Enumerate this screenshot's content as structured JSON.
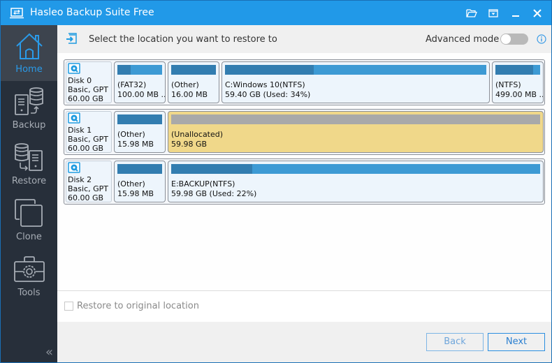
{
  "window": {
    "title": "Hasleo Backup Suite Free",
    "accent_color": "#2199e8",
    "titlebar_buttons": [
      "open-folder",
      "menu",
      "minimize",
      "close"
    ]
  },
  "sidebar": {
    "items": [
      {
        "label": "Home",
        "icon": "home-icon",
        "active": true
      },
      {
        "label": "Backup",
        "icon": "backup-icon",
        "active": false
      },
      {
        "label": "Restore",
        "icon": "restore-icon",
        "active": false
      },
      {
        "label": "Clone",
        "icon": "clone-icon",
        "active": false
      },
      {
        "label": "Tools",
        "icon": "tools-icon",
        "active": false
      }
    ],
    "collapse_glyph": "«"
  },
  "header": {
    "instruction": "Select the location you want to restore to",
    "advanced_mode_label": "Advanced mode",
    "advanced_mode_on": false
  },
  "disks": [
    {
      "name": "Disk 0",
      "type": "Basic, GPT",
      "size": "60.00 GB",
      "partitions": [
        {
          "label": "(FAT32)",
          "size": "100.00 MB ...",
          "used_fraction": 0.3,
          "unallocated": false
        },
        {
          "label": "(Other)",
          "size": "16.00 MB",
          "used_fraction": 1.0,
          "unallocated": false
        },
        {
          "label": "C:Windows 10(NTFS)",
          "size": "59.40 GB (Used: 34%)",
          "used_fraction": 0.34,
          "unallocated": false
        },
        {
          "label": "(NTFS)",
          "size": "499.00 MB ...",
          "used_fraction": 0.85,
          "unallocated": false
        }
      ]
    },
    {
      "name": "Disk 1",
      "type": "Basic, GPT",
      "size": "60.00 GB",
      "partitions": [
        {
          "label": "(Other)",
          "size": "15.98 MB",
          "used_fraction": 1.0,
          "unallocated": false
        },
        {
          "label": "(Unallocated)",
          "size": "59.98 GB",
          "used_fraction": 0,
          "unallocated": true
        }
      ]
    },
    {
      "name": "Disk 2",
      "type": "Basic, GPT",
      "size": "60.00 GB",
      "partitions": [
        {
          "label": "(Other)",
          "size": "15.98 MB",
          "used_fraction": 1.0,
          "unallocated": false
        },
        {
          "label": "E:BACKUP(NTFS)",
          "size": "59.98 GB (Used: 22%)",
          "used_fraction": 0.22,
          "unallocated": false
        }
      ]
    }
  ],
  "options": {
    "restore_original_label": "Restore to original location",
    "restore_original_checked": false
  },
  "footer": {
    "back_label": "Back",
    "next_label": "Next"
  }
}
